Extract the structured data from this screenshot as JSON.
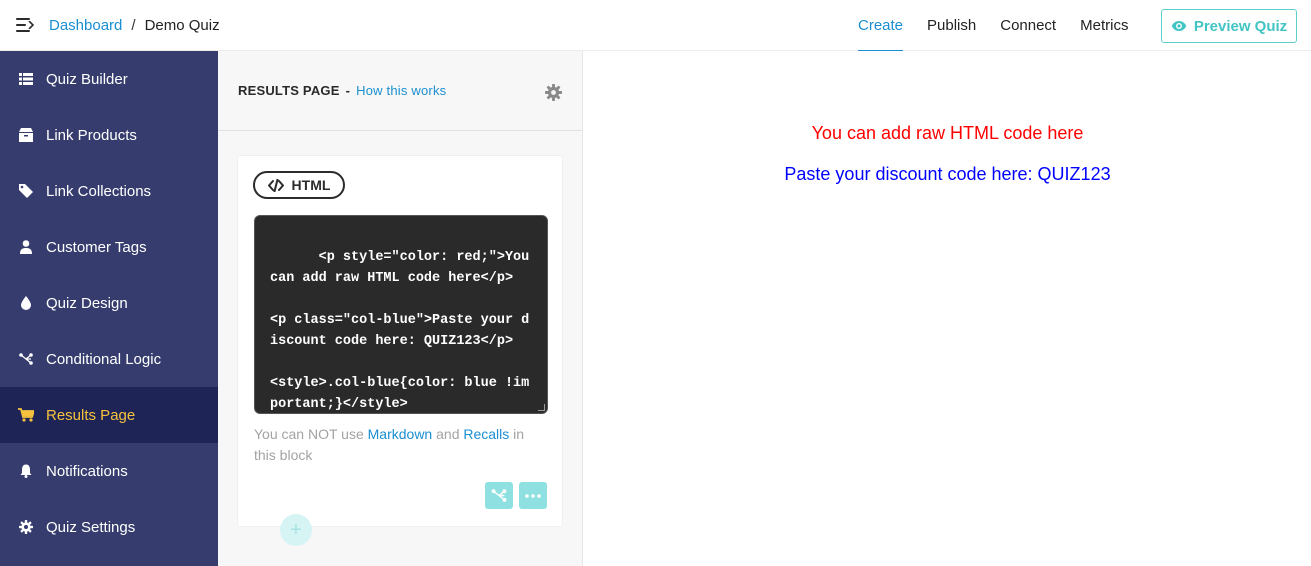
{
  "header": {
    "breadcrumb": {
      "root": "Dashboard",
      "separator": "/",
      "current": "Demo Quiz"
    },
    "tabs": [
      {
        "label": "Create",
        "active": true
      },
      {
        "label": "Publish",
        "active": false
      },
      {
        "label": "Connect",
        "active": false
      },
      {
        "label": "Metrics",
        "active": false
      }
    ],
    "preview_label": "Preview Quiz",
    "preview_icon": "eye-icon"
  },
  "sidebar": {
    "items": [
      {
        "label": "Quiz Builder",
        "icon": "list-icon",
        "active": false
      },
      {
        "label": "Link Products",
        "icon": "box-icon",
        "active": false
      },
      {
        "label": "Link Collections",
        "icon": "tag-icon",
        "active": false
      },
      {
        "label": "Customer Tags",
        "icon": "user-icon",
        "active": false
      },
      {
        "label": "Quiz Design",
        "icon": "droplet-icon",
        "active": false
      },
      {
        "label": "Conditional Logic",
        "icon": "branch-icon",
        "active": false
      },
      {
        "label": "Results Page",
        "icon": "cart-icon",
        "active": true
      },
      {
        "label": "Notifications",
        "icon": "bell-icon",
        "active": false
      },
      {
        "label": "Quiz Settings",
        "icon": "gear-icon",
        "active": false
      }
    ]
  },
  "editor": {
    "title": "RESULTS PAGE",
    "dash": "-",
    "how_link": "How this works",
    "block": {
      "type_label": "HTML",
      "code": "<p style=\"color: red;\">You can add raw HTML code here</p>\n\n<p class=\"col-blue\">Paste your discount code here: QUIZ123</p>\n\n<style>.col-blue{color: blue !important;}</style>",
      "note": {
        "prefix": "You can NOT use ",
        "markdown": "Markdown",
        "and": " and ",
        "recalls": "Recalls",
        "suffix": " in this block"
      }
    },
    "add_symbol": "+"
  },
  "preview": {
    "red_text": "You can add raw HTML code here",
    "blue_text": "Paste your discount code here: QUIZ123"
  },
  "colors": {
    "accent": "#1a8fd1",
    "teal": "#43c4c4",
    "sidebar_bg": "#363d6e",
    "sidebar_active_bg": "#1e2456",
    "sidebar_active_text": "#f6c23e"
  }
}
